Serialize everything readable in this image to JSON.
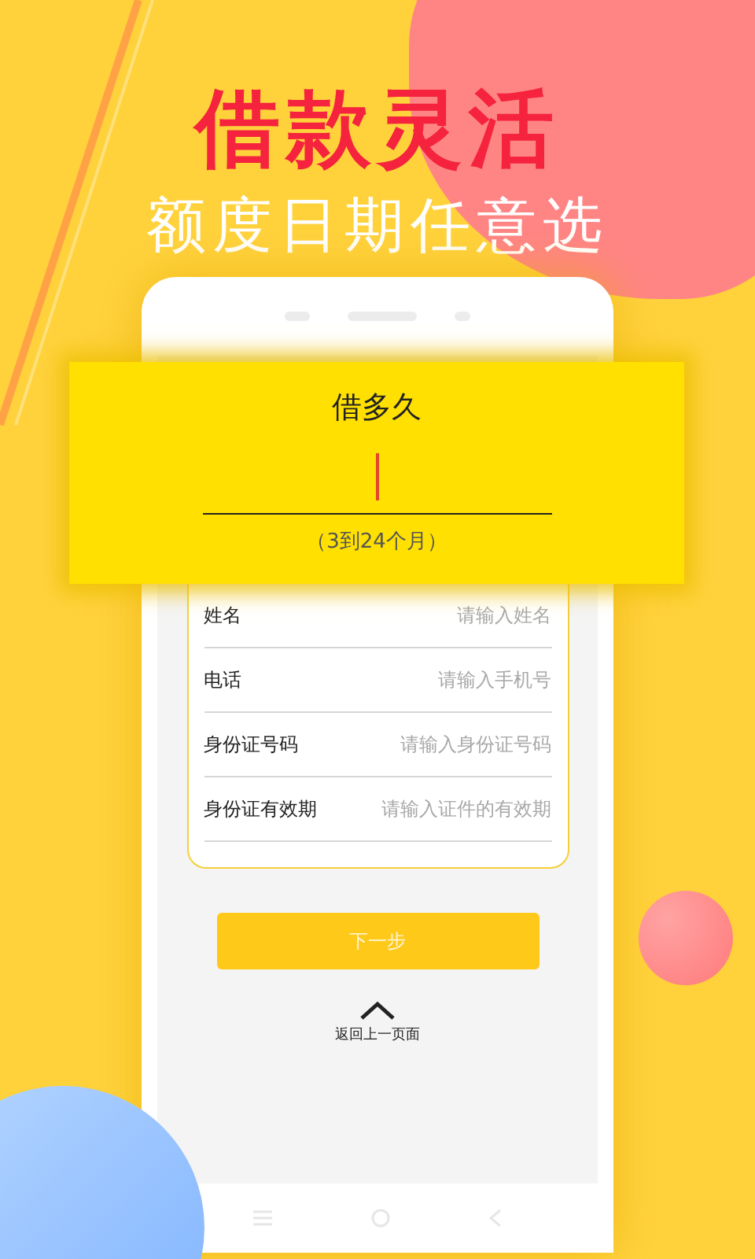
{
  "headline": "借款灵活",
  "subtitle": "额度日期任意选",
  "popup": {
    "title": "借多久",
    "hint": "（3到24个月）"
  },
  "form": {
    "rows": [
      {
        "label": "姓名",
        "placeholder": "请输入姓名"
      },
      {
        "label": "电话",
        "placeholder": "请输入手机号"
      },
      {
        "label": "身份证号码",
        "placeholder": "请输入身份证号码"
      },
      {
        "label": "身份证有效期",
        "placeholder": "请输入证件的有效期"
      }
    ]
  },
  "next_button": "下一步",
  "back_link": "返回上一页面"
}
